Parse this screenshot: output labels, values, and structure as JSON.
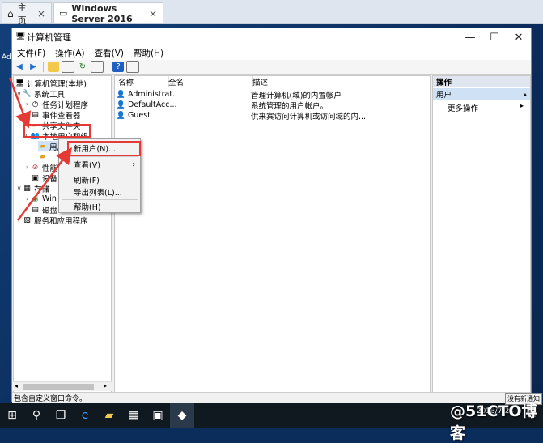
{
  "browser": {
    "tabs": [
      {
        "label": "主页"
      },
      {
        "label": "Windows Server 2016"
      }
    ]
  },
  "window": {
    "title": "计算机管理",
    "menu": [
      "文件(F)",
      "操作(A)",
      "查看(V)",
      "帮助(H)"
    ]
  },
  "tree": {
    "items": [
      {
        "label": "计算机管理(本地)"
      },
      {
        "label": "系统工具"
      },
      {
        "label": "任务计划程序"
      },
      {
        "label": "事件查看器"
      },
      {
        "label": "共享文件夹"
      },
      {
        "label": "本地用户和组"
      },
      {
        "label": "用户"
      },
      {
        "label": ""
      },
      {
        "label": "性能"
      },
      {
        "label": "设备"
      },
      {
        "label": "存储"
      },
      {
        "label": "Win"
      },
      {
        "label": "磁盘"
      },
      {
        "label": "服务和应用程序"
      }
    ]
  },
  "list": {
    "columns": [
      "名称",
      "全名",
      "描述"
    ],
    "rows": [
      {
        "name": "Administrat...",
        "fullname": "",
        "desc": "管理计算机(域)的内置帐户"
      },
      {
        "name": "DefaultAcc...",
        "fullname": "",
        "desc": "系统管理的用户帐户。"
      },
      {
        "name": "Guest",
        "fullname": "",
        "desc": "供来宾访问计算机或访问域的内..."
      }
    ]
  },
  "actions": {
    "header": "操作",
    "section": "用户",
    "more": "更多操作"
  },
  "context_menu": {
    "items": [
      "新用户(N)...",
      "查看(V)",
      "刷新(F)",
      "导出列表(L)...",
      "帮助(H)"
    ]
  },
  "status": "包含自定义窗口命令。",
  "taskbar": {
    "clock_time": "",
    "clock_date": "2018/7/23",
    "notification": "没有新通知"
  },
  "desktop_text": "Ad",
  "watermark": "@51CTO博客",
  "colors": {
    "highlight": "#e53935",
    "selection": "#cfe1f4"
  }
}
